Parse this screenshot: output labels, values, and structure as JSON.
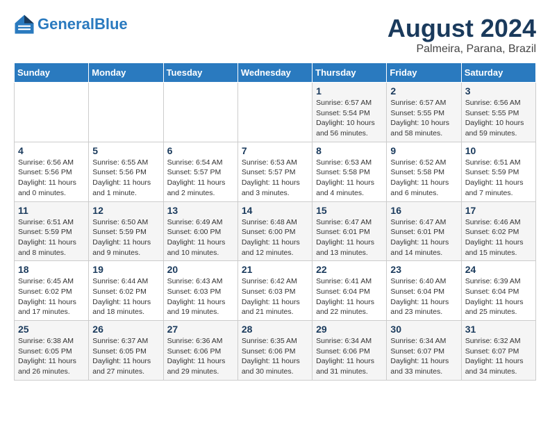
{
  "header": {
    "logo_line1": "General",
    "logo_line2": "Blue",
    "month_year": "August 2024",
    "location": "Palmeira, Parana, Brazil"
  },
  "days_of_week": [
    "Sunday",
    "Monday",
    "Tuesday",
    "Wednesday",
    "Thursday",
    "Friday",
    "Saturday"
  ],
  "weeks": [
    [
      {
        "day": "",
        "info": ""
      },
      {
        "day": "",
        "info": ""
      },
      {
        "day": "",
        "info": ""
      },
      {
        "day": "",
        "info": ""
      },
      {
        "day": "1",
        "info": "Sunrise: 6:57 AM\nSunset: 5:54 PM\nDaylight: 10 hours\nand 56 minutes."
      },
      {
        "day": "2",
        "info": "Sunrise: 6:57 AM\nSunset: 5:55 PM\nDaylight: 10 hours\nand 58 minutes."
      },
      {
        "day": "3",
        "info": "Sunrise: 6:56 AM\nSunset: 5:55 PM\nDaylight: 10 hours\nand 59 minutes."
      }
    ],
    [
      {
        "day": "4",
        "info": "Sunrise: 6:56 AM\nSunset: 5:56 PM\nDaylight: 11 hours\nand 0 minutes."
      },
      {
        "day": "5",
        "info": "Sunrise: 6:55 AM\nSunset: 5:56 PM\nDaylight: 11 hours\nand 1 minute."
      },
      {
        "day": "6",
        "info": "Sunrise: 6:54 AM\nSunset: 5:57 PM\nDaylight: 11 hours\nand 2 minutes."
      },
      {
        "day": "7",
        "info": "Sunrise: 6:53 AM\nSunset: 5:57 PM\nDaylight: 11 hours\nand 3 minutes."
      },
      {
        "day": "8",
        "info": "Sunrise: 6:53 AM\nSunset: 5:58 PM\nDaylight: 11 hours\nand 4 minutes."
      },
      {
        "day": "9",
        "info": "Sunrise: 6:52 AM\nSunset: 5:58 PM\nDaylight: 11 hours\nand 6 minutes."
      },
      {
        "day": "10",
        "info": "Sunrise: 6:51 AM\nSunset: 5:59 PM\nDaylight: 11 hours\nand 7 minutes."
      }
    ],
    [
      {
        "day": "11",
        "info": "Sunrise: 6:51 AM\nSunset: 5:59 PM\nDaylight: 11 hours\nand 8 minutes."
      },
      {
        "day": "12",
        "info": "Sunrise: 6:50 AM\nSunset: 5:59 PM\nDaylight: 11 hours\nand 9 minutes."
      },
      {
        "day": "13",
        "info": "Sunrise: 6:49 AM\nSunset: 6:00 PM\nDaylight: 11 hours\nand 10 minutes."
      },
      {
        "day": "14",
        "info": "Sunrise: 6:48 AM\nSunset: 6:00 PM\nDaylight: 11 hours\nand 12 minutes."
      },
      {
        "day": "15",
        "info": "Sunrise: 6:47 AM\nSunset: 6:01 PM\nDaylight: 11 hours\nand 13 minutes."
      },
      {
        "day": "16",
        "info": "Sunrise: 6:47 AM\nSunset: 6:01 PM\nDaylight: 11 hours\nand 14 minutes."
      },
      {
        "day": "17",
        "info": "Sunrise: 6:46 AM\nSunset: 6:02 PM\nDaylight: 11 hours\nand 15 minutes."
      }
    ],
    [
      {
        "day": "18",
        "info": "Sunrise: 6:45 AM\nSunset: 6:02 PM\nDaylight: 11 hours\nand 17 minutes."
      },
      {
        "day": "19",
        "info": "Sunrise: 6:44 AM\nSunset: 6:02 PM\nDaylight: 11 hours\nand 18 minutes."
      },
      {
        "day": "20",
        "info": "Sunrise: 6:43 AM\nSunset: 6:03 PM\nDaylight: 11 hours\nand 19 minutes."
      },
      {
        "day": "21",
        "info": "Sunrise: 6:42 AM\nSunset: 6:03 PM\nDaylight: 11 hours\nand 21 minutes."
      },
      {
        "day": "22",
        "info": "Sunrise: 6:41 AM\nSunset: 6:04 PM\nDaylight: 11 hours\nand 22 minutes."
      },
      {
        "day": "23",
        "info": "Sunrise: 6:40 AM\nSunset: 6:04 PM\nDaylight: 11 hours\nand 23 minutes."
      },
      {
        "day": "24",
        "info": "Sunrise: 6:39 AM\nSunset: 6:04 PM\nDaylight: 11 hours\nand 25 minutes."
      }
    ],
    [
      {
        "day": "25",
        "info": "Sunrise: 6:38 AM\nSunset: 6:05 PM\nDaylight: 11 hours\nand 26 minutes."
      },
      {
        "day": "26",
        "info": "Sunrise: 6:37 AM\nSunset: 6:05 PM\nDaylight: 11 hours\nand 27 minutes."
      },
      {
        "day": "27",
        "info": "Sunrise: 6:36 AM\nSunset: 6:06 PM\nDaylight: 11 hours\nand 29 minutes."
      },
      {
        "day": "28",
        "info": "Sunrise: 6:35 AM\nSunset: 6:06 PM\nDaylight: 11 hours\nand 30 minutes."
      },
      {
        "day": "29",
        "info": "Sunrise: 6:34 AM\nSunset: 6:06 PM\nDaylight: 11 hours\nand 31 minutes."
      },
      {
        "day": "30",
        "info": "Sunrise: 6:34 AM\nSunset: 6:07 PM\nDaylight: 11 hours\nand 33 minutes."
      },
      {
        "day": "31",
        "info": "Sunrise: 6:32 AM\nSunset: 6:07 PM\nDaylight: 11 hours\nand 34 minutes."
      }
    ]
  ]
}
